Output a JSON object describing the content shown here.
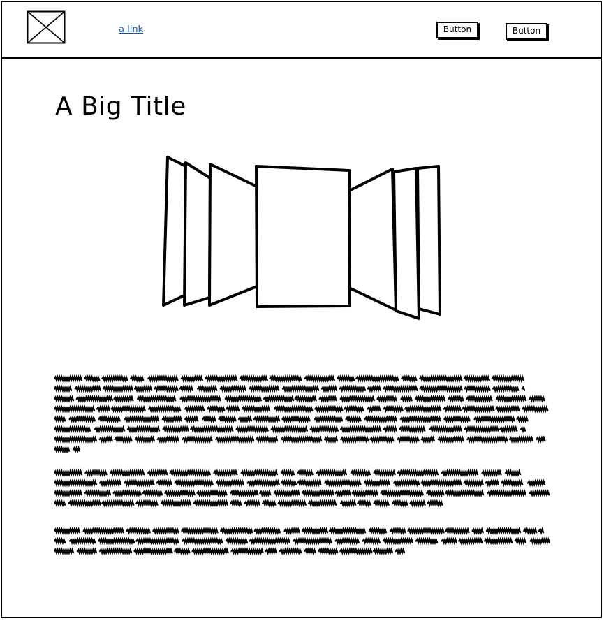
{
  "header": {
    "logo_icon": "image-placeholder-icon",
    "link_text": "a link",
    "buttons": [
      "Button",
      "Button"
    ]
  },
  "main": {
    "title": "A Big Title",
    "carousel_icon": "coverflow-carousel",
    "paragraphs": [
      {
        "lines": [
          1,
          1,
          1,
          1,
          1,
          1,
          1,
          0.05
        ]
      },
      {
        "lines": [
          1,
          1,
          1,
          0.82
        ]
      },
      {
        "lines": [
          1,
          1,
          0.74
        ]
      }
    ]
  },
  "colors": {
    "ink": "#000000",
    "link": "#0a4fb5",
    "background": "#ffffff"
  }
}
